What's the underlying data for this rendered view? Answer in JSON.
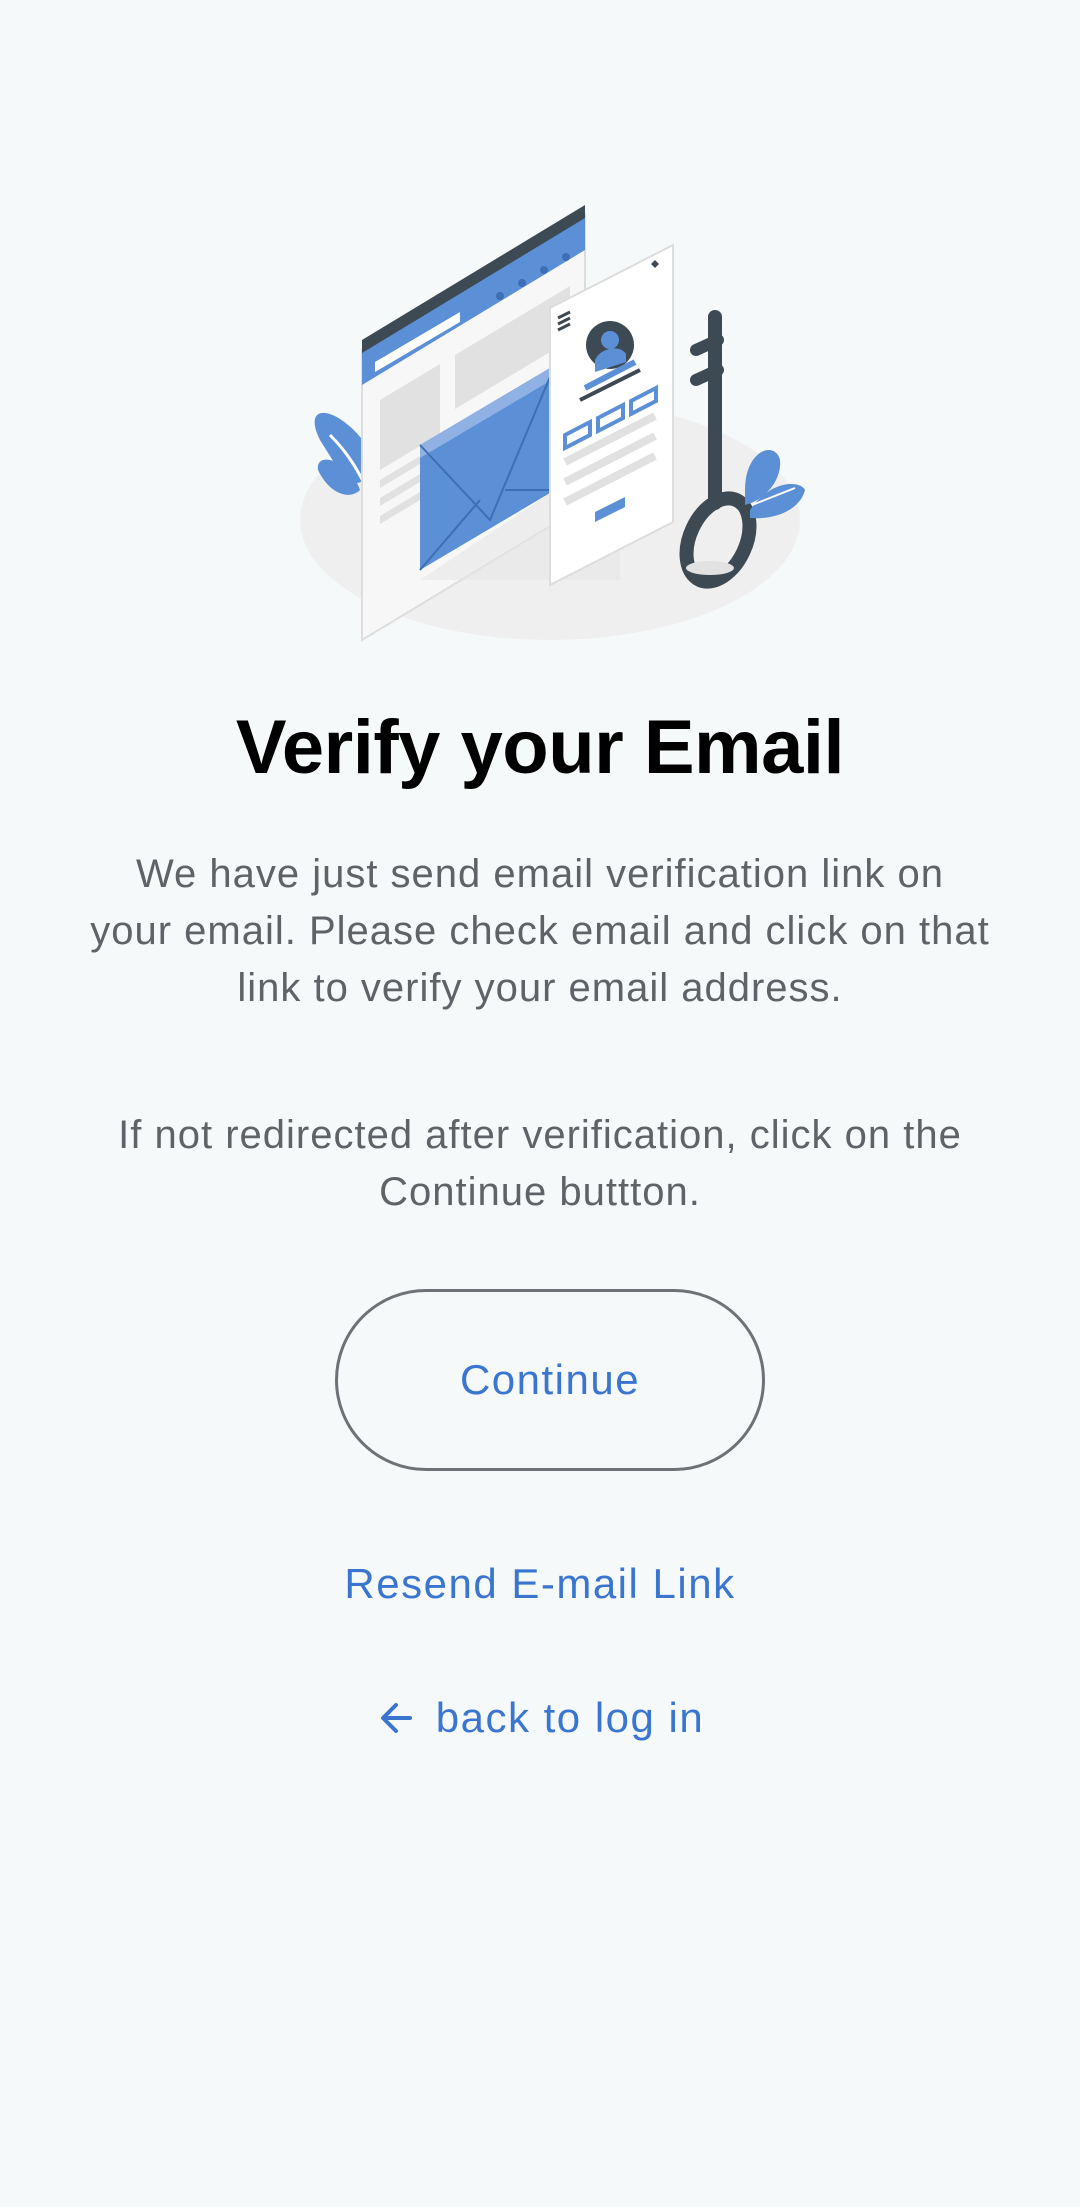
{
  "page": {
    "title": "Verify your Email",
    "description": "We have just send email verification link on your email. Please check email and click on that link to verify your email address.",
    "redirect_note": "If not redirected after verification, click on the Continue buttton."
  },
  "actions": {
    "continue_label": "Continue",
    "resend_label": "Resend E-mail Link",
    "back_label": "back to log in"
  },
  "icons": {
    "back": "arrow-left-icon",
    "illustration": "email-verification-illustration"
  },
  "colors": {
    "background": "#f6f9fa",
    "accent": "#3a75d0",
    "illustration_blue": "#5b8fd6",
    "illustration_dark": "#3d4a54",
    "text_muted": "#5f6266"
  }
}
